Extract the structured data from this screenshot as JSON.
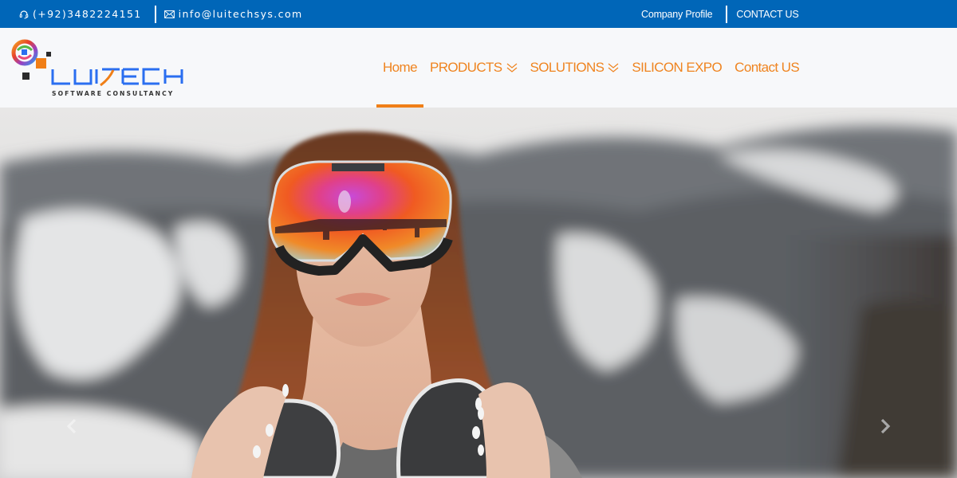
{
  "topbar": {
    "phone_icon": "headset-icon",
    "phone": "(+92)3482224151",
    "email_icon": "envelope-icon",
    "email": "info@luitechsys.com",
    "links": [
      {
        "label": "Company Profile"
      },
      {
        "label": "CONTACT US"
      }
    ],
    "background": "#0066b8"
  },
  "logo": {
    "name": "LUITECH",
    "tagline": "SOFTWARE CONSULTANCY",
    "colors": {
      "primary": "#2a6ef0",
      "accent": "#f07f17",
      "dark": "#2b2b2b"
    }
  },
  "nav": {
    "accent": "#ef8420",
    "items": [
      {
        "label": "Home",
        "active": true,
        "dropdown": false
      },
      {
        "label": "PRODUCTS",
        "active": false,
        "dropdown": true
      },
      {
        "label": "SOLUTIONS",
        "active": false,
        "dropdown": true
      },
      {
        "label": "SILICON EXPO",
        "active": false,
        "dropdown": false
      },
      {
        "label": "Contact US",
        "active": false,
        "dropdown": false
      }
    ]
  },
  "hero": {
    "image_alt": "Woman wearing reflective ski goggles holding a snowboard in snowy mountains",
    "prev_icon": "chevron-left-icon",
    "next_icon": "chevron-right-icon"
  }
}
